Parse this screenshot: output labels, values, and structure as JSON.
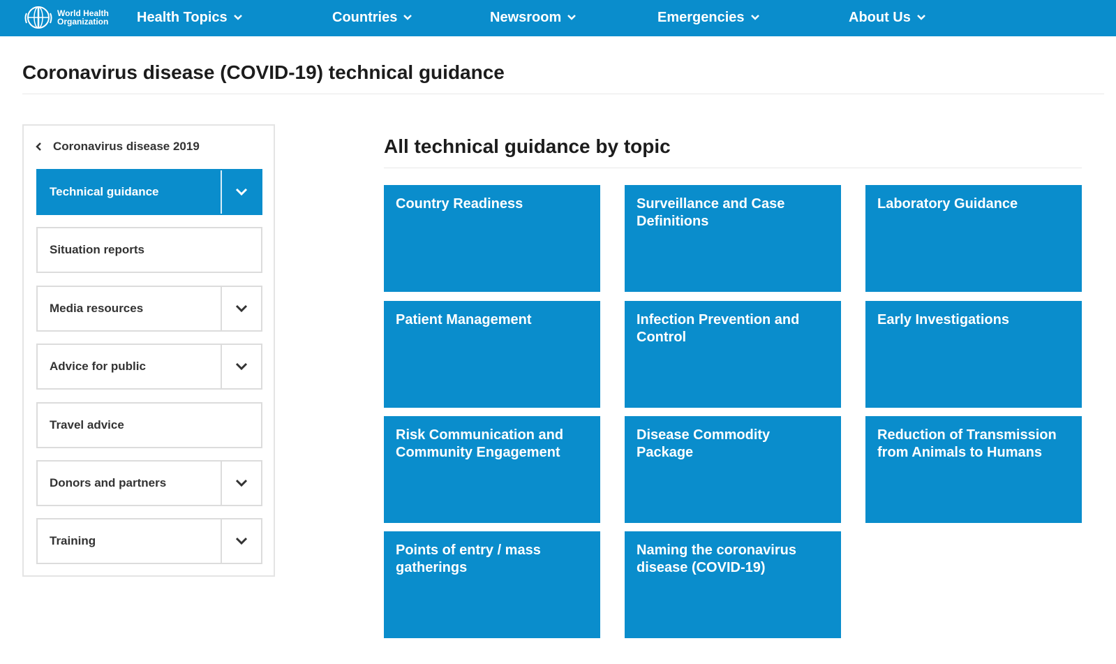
{
  "brand": {
    "logo_text": "World Health\nOrganization",
    "primary_color": "#0a8dcc"
  },
  "nav": {
    "items": [
      {
        "label": "Health Topics"
      },
      {
        "label": "Countries"
      },
      {
        "label": "Newsroom"
      },
      {
        "label": "Emergencies"
      },
      {
        "label": "About Us"
      }
    ]
  },
  "page": {
    "title": "Coronavirus disease (COVID-19) technical guidance"
  },
  "sidebar": {
    "back_label": "Coronavirus disease 2019",
    "items": [
      {
        "label": "Technical guidance",
        "active": true,
        "expandable": true
      },
      {
        "label": "Situation reports",
        "active": false,
        "expandable": false
      },
      {
        "label": "Media resources",
        "active": false,
        "expandable": true
      },
      {
        "label": "Advice for public",
        "active": false,
        "expandable": true
      },
      {
        "label": "Travel advice",
        "active": false,
        "expandable": false
      },
      {
        "label": "Donors and partners",
        "active": false,
        "expandable": true
      },
      {
        "label": "Training",
        "active": false,
        "expandable": true
      }
    ]
  },
  "main": {
    "heading": "All technical guidance by topic",
    "tiles": [
      {
        "label": "Country Readiness"
      },
      {
        "label": "Surveillance and Case Definitions"
      },
      {
        "label": "Laboratory Guidance"
      },
      {
        "label": "Patient Management"
      },
      {
        "label": "Infection Prevention and Control"
      },
      {
        "label": "Early Investigations"
      },
      {
        "label": "Risk Communication and Community Engagement"
      },
      {
        "label": "Disease Commodity Package"
      },
      {
        "label": "Reduction of Transmission from Animals to Humans"
      },
      {
        "label": "Points of entry / mass gatherings"
      },
      {
        "label": "Naming the coronavirus disease (COVID-19)"
      }
    ]
  }
}
